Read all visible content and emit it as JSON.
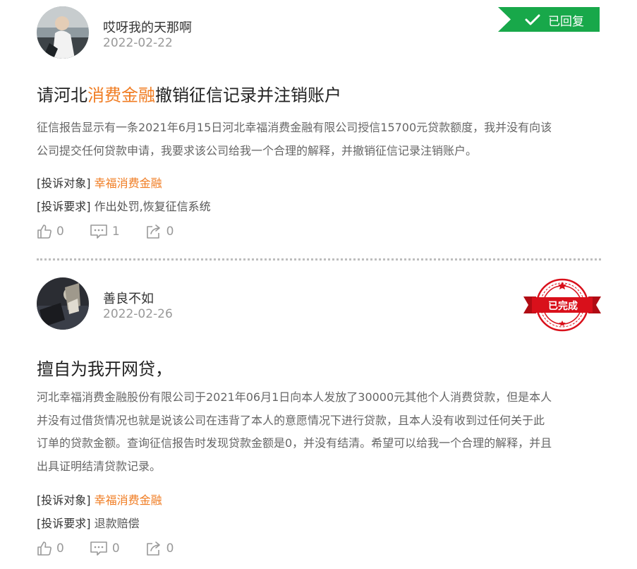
{
  "posts": [
    {
      "username": "哎呀我的天那啊",
      "date": "2022-02-22",
      "status": "已回复",
      "status_color": "#18a84a",
      "title_pre": "请河北",
      "title_highlight": "消费金融",
      "title_post": "撤销征信记录并注销账户",
      "content_lines": [
        "征信报告显示有一条2021年6月15日河北幸福消费金融有限公司授信15700元贷款额度，我并没有向该",
        "公司提交任何贷款申请，我要求该公司给我一个合理的解释，并撤销征信记录注销账户。"
      ],
      "target_label": "[投诉对象]",
      "target_value": "幸福消费金融",
      "demand_label": "[投诉要求]",
      "demand_value": "作出处罚,恢复征信系统",
      "likes": "0",
      "comments": "1",
      "shares": "0"
    },
    {
      "username": "善良不如",
      "date": "2022-02-26",
      "status": "已完成",
      "status_color": "#d9101b",
      "title": "擅自为我开网贷，",
      "content_lines": [
        "河北幸福消费金融股份有限公司于2021年06月1日向本人发放了30000元其他个人消费贷款，但是本人",
        "并没有过借货情况也就是说该公司在违背了本人的意愿情况下进行贷款，且本人没有收到过任何关于此",
        "订单的贷款金额。查询征信报告时发现贷款金额是0，并没有结清。希望可以给我一个合理的解释，并且",
        "出具证明结清贷款记录。"
      ],
      "target_label": "[投诉对象]",
      "target_value": "幸福消费金融",
      "demand_label": "[投诉要求]",
      "demand_value": "退款赔偿",
      "likes": "0",
      "comments": "0",
      "shares": "0"
    }
  ],
  "colors": {
    "accent_orange": "#f07c22",
    "muted_text": "#999999",
    "body_text": "#666666",
    "divider": "#bdbdbd"
  },
  "icons": [
    "like-icon",
    "comment-icon",
    "share-icon",
    "check-icon"
  ]
}
